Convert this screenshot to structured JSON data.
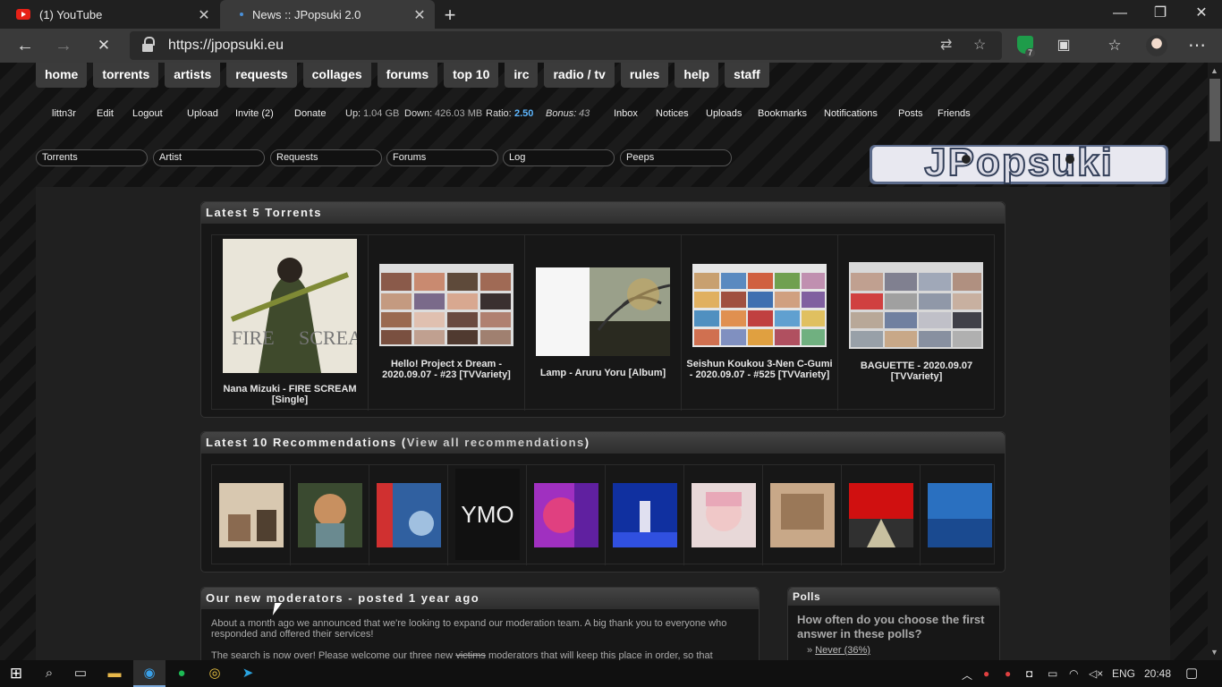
{
  "browser": {
    "tabs": [
      {
        "title": "(1) YouTube",
        "favicon": "youtube-icon"
      },
      {
        "title": "News :: JPopsuki 2.0",
        "favicon": "page-icon"
      }
    ],
    "url": "https://jpopsuki.eu",
    "extension_badge": "7"
  },
  "site": {
    "nav": [
      "home",
      "torrents",
      "artists",
      "requests",
      "collages",
      "forums",
      "top 10",
      "irc",
      "radio / tv",
      "rules",
      "help",
      "staff"
    ],
    "userbar": {
      "username": "littn3r",
      "edit": "Edit",
      "logout": "Logout",
      "upload": "Upload",
      "invite": "Invite (2)",
      "donate": "Donate",
      "up_label": "Up:",
      "up_value": "1.04 GB",
      "down_label": "Down:",
      "down_value": "426.03 MB",
      "ratio_label": "Ratio:",
      "ratio_value": "2.50",
      "bonus_label": "Bonus:",
      "bonus_value": "43",
      "inbox": "Inbox",
      "notices": "Notices",
      "uploads": "Uploads",
      "bookmarks": "Bookmarks",
      "notifications": "Notifications",
      "posts": "Posts",
      "friends": "Friends"
    },
    "search_boxes": [
      "Torrents",
      "Artist",
      "Requests",
      "Forums",
      "Log",
      "Peeps"
    ],
    "logo_text": "JPopsuki"
  },
  "latest_torrents": {
    "heading": "Latest 5 Torrents",
    "items": [
      {
        "caption": "Nana Mizuki - FIRE SCREAM [Single]"
      },
      {
        "caption": "Hello! Project x Dream - 2020.09.07 - #23 [TVVariety]"
      },
      {
        "caption": "Lamp - Aruru Yoru [Album]"
      },
      {
        "caption": "Seishun Koukou 3-Nen C-Gumi - 2020.09.07 - #525 [TVVariety]"
      },
      {
        "caption": "BAGUETTE - 2020.09.07 [TVVariety]"
      }
    ]
  },
  "recommendations": {
    "heading": "Latest 10 Recommendations (",
    "link": "View all recommendations",
    "heading_end": ")",
    "covers": [
      "cover-1",
      "cover-2",
      "cover-3",
      "cover-4",
      "cover-5",
      "cover-6",
      "cover-7",
      "cover-8",
      "cover-9",
      "cover-10"
    ]
  },
  "news": {
    "heading": "Our new moderators - posted 1 year ago",
    "p1": "About a month ago we announced that we're looking to expand our moderation team. A big thank you to everyone who responded and offered their services!",
    "p2_start": "The search is now over! Please welcome our three new ",
    "p2_strike": "victims",
    "p2_end": " moderators that will keep this place in order, so that"
  },
  "polls": {
    "heading": "Polls",
    "question": "How often do you choose the first answer in these polls?",
    "option_prefix": "» ",
    "option": "Never (36%)"
  },
  "taskbar": {
    "lang": "ENG",
    "time": "20:48"
  }
}
